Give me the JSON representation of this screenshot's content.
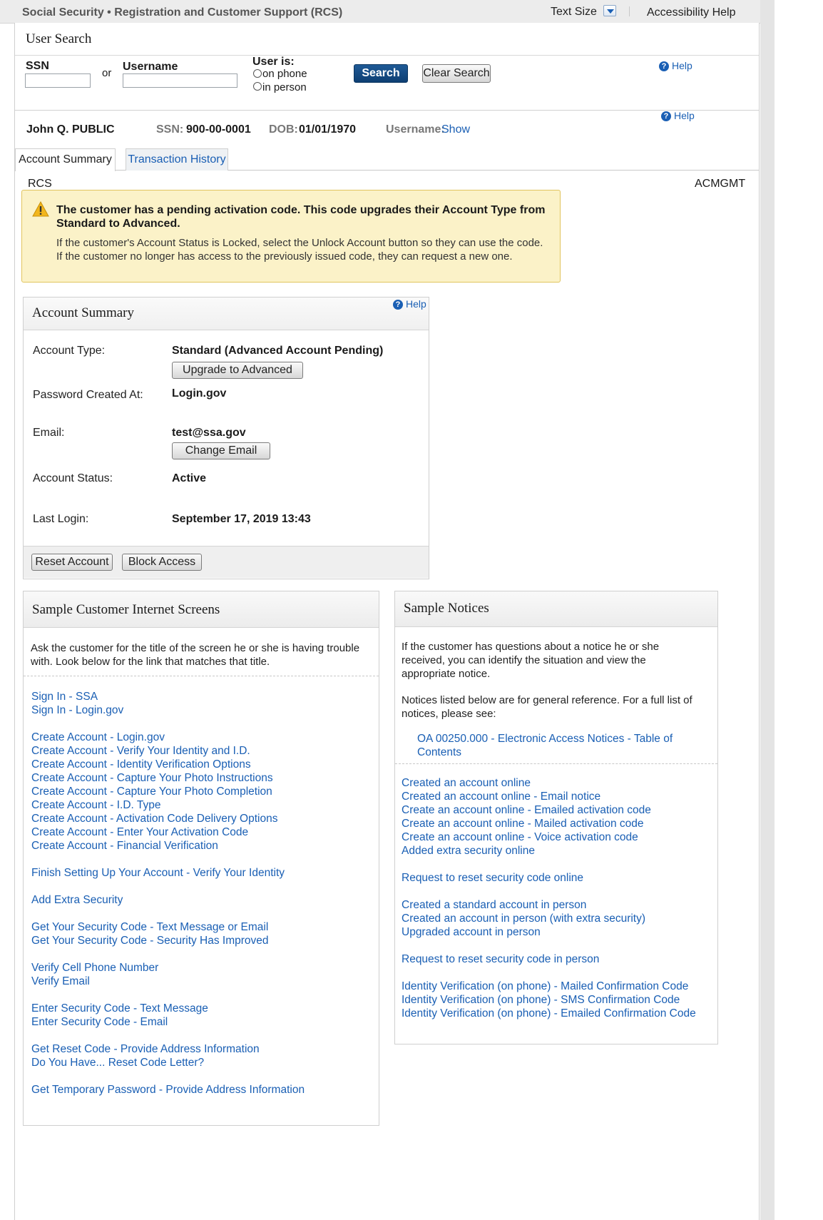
{
  "topbar": {
    "title": "Social Security • Registration and Customer Support (RCS)",
    "text_size": "Text Size",
    "accessibility": "Accessibility Help"
  },
  "user_search": {
    "title": "User Search",
    "ssn_label": "SSN",
    "or": "or",
    "username_label": "Username",
    "user_is_label": "User is:",
    "on_phone": "on phone",
    "in_person": "in person",
    "search_button": "Search",
    "clear_button": "Clear Search",
    "help": "Help"
  },
  "person": {
    "name": "John Q. PUBLIC",
    "ssn_label": "SSN:",
    "ssn_value": "900-00-0001",
    "dob_label": "DOB:",
    "dob_value": "01/01/1970",
    "username_label": "Username:",
    "username_link": "Show",
    "help": "Help"
  },
  "tabs": [
    {
      "label": "Account Summary",
      "active": true
    },
    {
      "label": "Transaction History",
      "active": false
    }
  ],
  "context": {
    "left": "RCS",
    "right": "ACMGMT"
  },
  "alert": {
    "heading": "The customer has a pending activation code. This code upgrades their Account Type from Standard to Advanced.",
    "body": "If the customer's Account Status is Locked, select the Unlock Account button so they can use the code. If the customer no longer has access to the previously issued code, they can request a new one."
  },
  "account_summary": {
    "title": "Account Summary",
    "help": "Help",
    "account_type_label": "Account Type:",
    "account_type_value": "Standard (Advanced Account Pending)",
    "upgrade_button": "Upgrade to Advanced",
    "password_label": "Password Created At:",
    "password_value": "Login.gov",
    "email_label": "Email:",
    "email_value": "test@ssa.gov",
    "change_email_button": "Change Email",
    "status_label": "Account Status:",
    "status_value": "Active",
    "last_login_label": "Last Login:",
    "last_login_value": "September 17, 2019 13:43",
    "reset_button": "Reset Account",
    "block_button": "Block Access"
  },
  "screens": {
    "title": "Sample Customer Internet Screens",
    "intro": "Ask the customer for the title of the screen he or she is having trouble with. Look below for the link that matches that title.",
    "links": [
      "Sign In - SSA",
      "Sign In - Login.gov",
      "Create Account - Login.gov",
      "Create Account - Verify Your Identity and I.D.",
      "Create Account - Identity Verification Options",
      "Create Account - Capture Your Photo Instructions",
      "Create Account - Capture Your Photo Completion",
      "Create Account - I.D. Type",
      "Create Account - Activation Code Delivery Options",
      "Create Account - Enter Your Activation Code",
      "Create Account - Financial Verification",
      "Finish Setting Up Your Account - Verify Your Identity",
      "Add Extra Security",
      "Get Your Security Code - Text Message or Email",
      "Get Your Security Code - Security Has Improved",
      "Verify Cell Phone Number",
      "Verify Email",
      "Enter Security Code - Text Message",
      "Enter Security Code - Email",
      "Get Reset Code - Provide Address Information",
      "Do You Have... Reset Code Letter?",
      "Get Temporary Password - Provide Address Information"
    ]
  },
  "notices": {
    "title": "Sample Notices",
    "intro1": "If the customer has questions about a notice he or she received, you can identify the situation and view the appropriate notice.",
    "intro2": "Notices listed below are for general reference. For a full list of notices, please see:",
    "reference_link": "OA 00250.000 - Electronic Access Notices - Table of Contents",
    "links": [
      "Created an account online",
      "Created an account online - Email notice",
      "Create an account online - Emailed activation code",
      "Create an account online - Mailed activation code",
      "Create an account online - Voice activation code",
      "Added extra security online",
      "Request to reset security code online",
      "Created a standard account in person",
      "Created an account in person (with extra security)",
      "Upgraded account in person",
      "Request to reset security code in person",
      "Identity Verification (on phone) - Mailed Confirmation Code",
      "Identity Verification (on phone) - SMS Confirmation Code",
      "Identity Verification (on phone) - Emailed Confirmation Code"
    ]
  }
}
